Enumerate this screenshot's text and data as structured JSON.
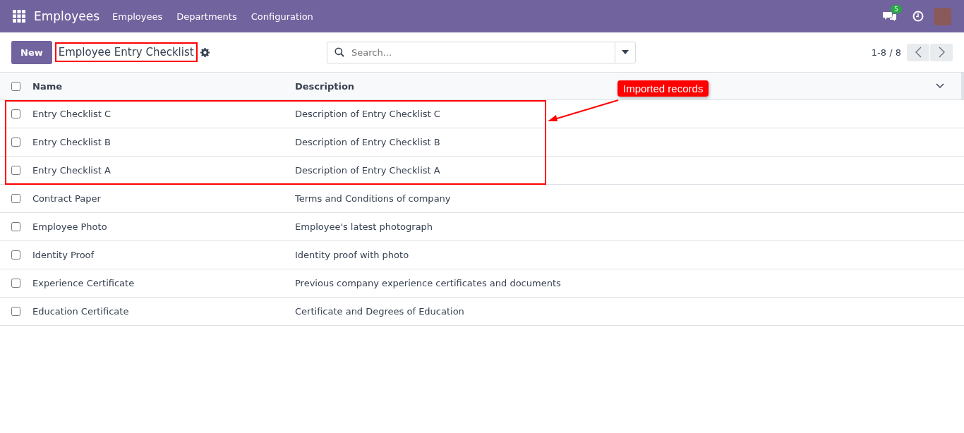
{
  "navbar": {
    "app_name": "Employees",
    "menu": [
      "Employees",
      "Departments",
      "Configuration"
    ],
    "message_count": "5"
  },
  "control_panel": {
    "new_button": "New",
    "title": "Employee Entry Checklist",
    "title_highlighted": true,
    "search": {
      "placeholder": "Search..."
    },
    "pager": "1-8 / 8"
  },
  "table": {
    "columns": [
      "Name",
      "Description"
    ],
    "select_all_checked": false,
    "rows": [
      {
        "name": "Entry Checklist C",
        "description": "Description of Entry Checklist C",
        "checked": false,
        "highlighted": true
      },
      {
        "name": "Entry Checklist B",
        "description": "Description of Entry Checklist B",
        "checked": false,
        "highlighted": true
      },
      {
        "name": "Entry Checklist A",
        "description": "Description of Entry Checklist A",
        "checked": false,
        "highlighted": true
      },
      {
        "name": "Contract Paper",
        "description": "Terms and Conditions of company",
        "checked": false,
        "highlighted": false
      },
      {
        "name": "Employee Photo",
        "description": "Employee's latest photograph",
        "checked": false,
        "highlighted": false
      },
      {
        "name": "Identity Proof",
        "description": "Identity proof with photo",
        "checked": false,
        "highlighted": false
      },
      {
        "name": "Experience Certificate",
        "description": "Previous company experience certificates and documents",
        "checked": false,
        "highlighted": false
      },
      {
        "name": "Education Certificate",
        "description": "Certificate and Degrees of Education",
        "checked": false,
        "highlighted": false
      }
    ]
  },
  "annotation": {
    "callout": "Imported records"
  }
}
